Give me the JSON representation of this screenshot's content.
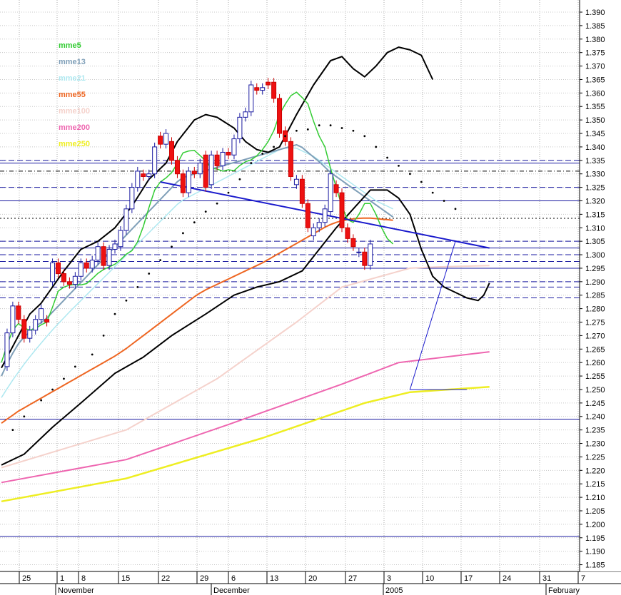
{
  "chart_data": {
    "type": "line",
    "title": "",
    "xlabel": "",
    "ylabel": "",
    "ylim": [
      1.1825,
      1.3945
    ],
    "y_ticks": [
      "1.390",
      "1.385",
      "1.380",
      "1.375",
      "1.370",
      "1.365",
      "1.360",
      "1.355",
      "1.350",
      "1.345",
      "1.340",
      "1.335",
      "1.330",
      "1.325",
      "1.320",
      "1.315",
      "1.310",
      "1.305",
      "1.300",
      "1.295",
      "1.290",
      "1.285",
      "1.280",
      "1.275",
      "1.270",
      "1.265",
      "1.260",
      "1.255",
      "1.250",
      "1.245",
      "1.240",
      "1.235",
      "1.230",
      "1.225",
      "1.220",
      "1.215",
      "1.210",
      "1.205",
      "1.200",
      "1.195",
      "1.190",
      "1.185"
    ],
    "x_day_ticks": [
      "25",
      "1",
      "8",
      "15",
      "22",
      "29",
      "6",
      "13",
      "20",
      "27",
      "3",
      "10",
      "17",
      "24",
      "31",
      "7"
    ],
    "x_month_labels": [
      "November",
      "December",
      "2005",
      "February"
    ],
    "legend": [
      {
        "name": "mme5",
        "color": "#33cc33"
      },
      {
        "name": "mme13",
        "color": "#7f9fb8"
      },
      {
        "name": "mme21",
        "color": "#aee8f0"
      },
      {
        "name": "mme55",
        "color": "#ee6622"
      },
      {
        "name": "mme100",
        "color": "#f5d2cc"
      },
      {
        "name": "mme200",
        "color": "#ee66b0"
      },
      {
        "name": "mme250",
        "color": "#eeee22"
      }
    ],
    "grid": true,
    "legend_position": "top-left",
    "candles": [
      [
        1.2585,
        1.271
      ],
      [
        1.271,
        1.281
      ],
      [
        1.281,
        1.276
      ],
      [
        1.276,
        1.269
      ],
      [
        1.269,
        1.272
      ],
      [
        1.272,
        1.276
      ],
      [
        1.276,
        1.28
      ],
      [
        1.276,
        1.275
      ],
      [
        1.29,
        1.297
      ],
      [
        1.297,
        1.293
      ],
      [
        1.293,
        1.29
      ],
      [
        1.29,
        1.289
      ],
      [
        1.289,
        1.292
      ],
      [
        1.292,
        1.297
      ],
      [
        1.297,
        1.295
      ],
      [
        1.295,
        1.298
      ],
      [
        1.298,
        1.303
      ],
      [
        1.303,
        1.296
      ],
      [
        1.296,
        1.302
      ],
      [
        1.302,
        1.304
      ],
      [
        1.303,
        1.309
      ],
      [
        1.309,
        1.317
      ],
      [
        1.317,
        1.325
      ],
      [
        1.325,
        1.331
      ],
      [
        1.33,
        1.329
      ],
      [
        1.329,
        1.33
      ],
      [
        1.33,
        1.34
      ],
      [
        1.344,
        1.341
      ],
      [
        1.341,
        1.345
      ],
      [
        1.342,
        1.335
      ],
      [
        1.335,
        1.33
      ],
      [
        1.33,
        1.323
      ],
      [
        1.323,
        1.331
      ],
      [
        1.331,
        1.33
      ],
      [
        1.33,
        1.334
      ],
      [
        1.337,
        1.325
      ],
      [
        1.326,
        1.337
      ],
      [
        1.337,
        1.333
      ],
      [
        1.333,
        1.338
      ],
      [
        1.338,
        1.337
      ],
      [
        1.337,
        1.343
      ],
      [
        1.343,
        1.351
      ],
      [
        1.351,
        1.353
      ],
      [
        1.353,
        1.363
      ],
      [
        1.362,
        1.361
      ],
      [
        1.361,
        1.362
      ],
      [
        1.364,
        1.363
      ],
      [
        1.364,
        1.358
      ],
      [
        1.358,
        1.345
      ],
      [
        1.346,
        1.342
      ],
      [
        1.342,
        1.329
      ],
      [
        1.326,
        1.328
      ],
      [
        1.328,
        1.319
      ],
      [
        1.319,
        1.31
      ],
      [
        1.307,
        1.31
      ],
      [
        1.31,
        1.312
      ],
      [
        1.312,
        1.317
      ],
      [
        1.316,
        1.33
      ],
      [
        1.326,
        1.323
      ],
      [
        1.323,
        1.31
      ],
      [
        1.31,
        1.306
      ],
      [
        1.306,
        1.303
      ],
      [
        1.301,
        1.301
      ],
      [
        1.301,
        1.296
      ],
      [
        1.296,
        1.304
      ]
    ],
    "series": [
      {
        "name": "mme5",
        "values": [
          1.26,
          1.2665,
          1.272,
          1.2745,
          1.2728,
          1.272,
          1.2726,
          1.274,
          1.275,
          1.2805,
          1.2865,
          1.288,
          1.2887,
          1.289,
          1.2888,
          1.2893,
          1.2911,
          1.2931,
          1.2945,
          1.2955,
          1.2965,
          1.2982,
          1.3002,
          1.3015,
          1.3048,
          1.3105,
          1.3175,
          1.324,
          1.327,
          1.3285,
          1.3305,
          1.3339,
          1.3378,
          1.3385,
          1.3387,
          1.3368,
          1.3348,
          1.332,
          1.3318,
          1.331,
          1.3315,
          1.3312,
          1.3331,
          1.3345,
          1.3352,
          1.3367,
          1.339,
          1.342,
          1.346,
          1.3521,
          1.3558,
          1.359,
          1.3603,
          1.3583,
          1.356,
          1.3495,
          1.344,
          1.34,
          1.332,
          1.325,
          1.318,
          1.313,
          1.312,
          1.315,
          1.319,
          1.319,
          1.315,
          1.31,
          1.306,
          1.304
        ]
      },
      {
        "name": "mme13",
        "values": [
          1.255,
          1.2595,
          1.2635,
          1.267,
          1.2695,
          1.2713,
          1.2735,
          1.2748,
          1.2765,
          1.2787,
          1.2809,
          1.2831,
          1.2853,
          1.2875,
          1.2897,
          1.2919,
          1.2941,
          1.2963,
          1.2985,
          1.3007,
          1.3029,
          1.3051,
          1.3073,
          1.3095,
          1.3117,
          1.3139,
          1.3161,
          1.3183,
          1.3205,
          1.3227,
          1.3249,
          1.3271,
          1.3286,
          1.3293,
          1.33,
          1.3306,
          1.3312,
          1.3318,
          1.3324,
          1.333,
          1.3336,
          1.3342,
          1.3348,
          1.3354,
          1.336,
          1.3366,
          1.3372,
          1.3378,
          1.3384,
          1.339,
          1.3396,
          1.3402,
          1.3408,
          1.3398,
          1.338,
          1.3362,
          1.3345,
          1.3325,
          1.3305,
          1.329,
          1.3275,
          1.326,
          1.3245,
          1.323,
          1.3215,
          1.32,
          1.3185,
          1.317,
          1.3155,
          1.314
        ]
      },
      {
        "name": "mme21",
        "values": [
          1.247,
          1.2503,
          1.2535,
          1.2565,
          1.2594,
          1.2621,
          1.2647,
          1.2672,
          1.2697,
          1.2721,
          1.2744,
          1.2766,
          1.2788,
          1.2809,
          1.283,
          1.2851,
          1.2872,
          1.2893,
          1.2914,
          1.2935,
          1.2956,
          1.2977,
          1.2998,
          1.3019,
          1.304,
          1.3061,
          1.3082,
          1.3103,
          1.3124,
          1.3145,
          1.3166,
          1.3187,
          1.3203,
          1.3214,
          1.3225,
          1.3236,
          1.3247,
          1.3258,
          1.3269,
          1.328,
          1.3291,
          1.3302,
          1.3313,
          1.3324,
          1.3335,
          1.3346,
          1.3357,
          1.3368,
          1.3379,
          1.339,
          1.3395,
          1.3397,
          1.3395,
          1.3385,
          1.3375,
          1.3365,
          1.335,
          1.3335,
          1.332,
          1.3305,
          1.329,
          1.3275,
          1.326,
          1.3245,
          1.323,
          1.3215,
          1.32,
          1.319,
          1.318,
          1.317
        ]
      },
      {
        "name": "mme55",
        "values": [
          1.2375,
          1.239,
          1.2405,
          1.242,
          1.2432,
          1.2444,
          1.2456,
          1.2468,
          1.248,
          1.2492,
          1.2504,
          1.2516,
          1.2528,
          1.254,
          1.2552,
          1.2564,
          1.2576,
          1.2588,
          1.26,
          1.2612,
          1.2624,
          1.2638,
          1.2652,
          1.2668,
          1.2684,
          1.27,
          1.2716,
          1.2732,
          1.2748,
          1.2764,
          1.278,
          1.2796,
          1.2812,
          1.2828,
          1.2844,
          1.2858,
          1.287,
          1.288,
          1.289,
          1.29,
          1.291,
          1.292,
          1.293,
          1.294,
          1.295,
          1.296,
          1.297,
          1.2982,
          1.2994,
          1.3006,
          1.3018,
          1.303,
          1.3042,
          1.3054,
          1.3066,
          1.3078,
          1.309,
          1.3102,
          1.3112,
          1.312,
          1.3126,
          1.313,
          1.3133,
          1.3135,
          1.3136,
          1.3136,
          1.3134,
          1.3132,
          1.313,
          1.3128
        ]
      }
    ],
    "bands_upper_points": [
      [
        1.258,
        0
      ],
      [
        1.27,
        3
      ],
      [
        1.278,
        5
      ],
      [
        1.282,
        7
      ],
      [
        1.288,
        9
      ],
      [
        1.294,
        11
      ],
      [
        1.302,
        14
      ],
      [
        1.305,
        17
      ],
      [
        1.31,
        20
      ],
      [
        1.318,
        23
      ],
      [
        1.328,
        26
      ],
      [
        1.334,
        29
      ],
      [
        1.342,
        31
      ],
      [
        1.35,
        34
      ],
      [
        1.352,
        36
      ],
      [
        1.351,
        38
      ],
      [
        1.347,
        41
      ],
      [
        1.342,
        43
      ],
      [
        1.339,
        45
      ],
      [
        1.338,
        47
      ],
      [
        1.34,
        49
      ],
      [
        1.352,
        52
      ],
      [
        1.363,
        55
      ],
      [
        1.372,
        58
      ],
      [
        1.3735,
        60
      ],
      [
        1.369,
        62
      ],
      [
        1.366,
        64
      ],
      [
        1.37,
        66
      ],
      [
        1.375,
        68
      ],
      [
        1.377,
        70
      ],
      [
        1.376,
        72
      ],
      [
        1.374,
        74
      ],
      [
        1.365,
        76
      ]
    ],
    "bands_lower_points": [
      [
        1.222,
        0
      ],
      [
        1.226,
        4
      ],
      [
        1.236,
        9
      ],
      [
        1.245,
        14
      ],
      [
        1.256,
        20
      ],
      [
        1.262,
        25
      ],
      [
        1.27,
        30
      ],
      [
        1.278,
        36
      ],
      [
        1.285,
        41
      ],
      [
        1.288,
        45
      ],
      [
        1.29,
        49
      ],
      [
        1.294,
        53
      ],
      [
        1.302,
        56
      ],
      [
        1.31,
        59
      ],
      [
        1.317,
        62
      ],
      [
        1.324,
        65
      ],
      [
        1.324,
        68
      ],
      [
        1.321,
        70
      ],
      [
        1.315,
        72
      ],
      [
        1.302,
        74
      ],
      [
        1.292,
        76
      ],
      [
        1.288,
        78
      ],
      [
        1.286,
        80
      ],
      [
        1.284,
        82
      ],
      [
        1.283,
        84
      ],
      [
        1.285,
        85
      ],
      [
        1.2895,
        86
      ]
    ],
    "mme100_points": [
      [
        1.221,
        0
      ],
      [
        1.235,
        22
      ],
      [
        1.254,
        38
      ],
      [
        1.275,
        52
      ],
      [
        1.288,
        60
      ],
      [
        1.295,
        72
      ],
      [
        1.2955,
        77
      ],
      [
        1.296,
        86
      ]
    ],
    "mme200_points": [
      [
        1.2155,
        0
      ],
      [
        1.224,
        22
      ],
      [
        1.237,
        40
      ],
      [
        1.252,
        60
      ],
      [
        1.26,
        70
      ],
      [
        1.264,
        86
      ]
    ],
    "mme250_points": [
      [
        1.2085,
        0
      ],
      [
        1.217,
        22
      ],
      [
        1.232,
        46
      ],
      [
        1.245,
        64
      ],
      [
        1.249,
        72
      ],
      [
        1.251,
        86
      ]
    ],
    "trend_line": [
      [
        1.327,
        28
      ],
      [
        1.3025,
        86
      ]
    ],
    "support_line": [
      [
        1.25,
        72
      ],
      [
        1.305,
        80
      ]
    ],
    "support_base": [
      [
        1.25,
        72
      ],
      [
        1.25,
        82
      ]
    ],
    "psar_dots": [
      [
        1.235,
        2
      ],
      [
        1.24,
        4
      ],
      [
        1.246,
        7
      ],
      [
        1.25,
        9
      ],
      [
        1.254,
        11
      ],
      [
        1.2585,
        13
      ],
      [
        1.263,
        16
      ],
      [
        1.27,
        18
      ],
      [
        1.278,
        20
      ],
      [
        1.283,
        22
      ],
      [
        1.288,
        24
      ],
      [
        1.293,
        26
      ],
      [
        1.298,
        28
      ],
      [
        1.303,
        30
      ],
      [
        1.308,
        32
      ],
      [
        1.312,
        34
      ],
      [
        1.316,
        36
      ],
      [
        1.319,
        38
      ],
      [
        1.323,
        40
      ],
      [
        1.328,
        42
      ],
      [
        1.334,
        44
      ],
      [
        1.3375,
        46
      ],
      [
        1.34,
        48
      ],
      [
        1.344,
        50
      ],
      [
        1.346,
        52
      ],
      [
        1.3465,
        54
      ],
      [
        1.348,
        56
      ],
      [
        1.348,
        58
      ],
      [
        1.347,
        60
      ],
      [
        1.346,
        62
      ],
      [
        1.344,
        64
      ],
      [
        1.34,
        66
      ],
      [
        1.336,
        68
      ],
      [
        1.333,
        70
      ],
      [
        1.33,
        72
      ],
      [
        1.327,
        74
      ],
      [
        1.323,
        76
      ],
      [
        1.32,
        78
      ],
      [
        1.317,
        80
      ]
    ],
    "h_lines": [
      {
        "y": 1.335,
        "style": "dash"
      },
      {
        "y": 1.334,
        "style": "solid"
      },
      {
        "y": 1.331,
        "style": "dashdot"
      },
      {
        "y": 1.325,
        "style": "dash"
      },
      {
        "y": 1.32,
        "style": "solid"
      },
      {
        "y": 1.3135,
        "style": "dot"
      },
      {
        "y": 1.305,
        "style": "dash"
      },
      {
        "y": 1.3025,
        "style": "solid"
      },
      {
        "y": 1.3,
        "style": "dash"
      },
      {
        "y": 1.2975,
        "style": "dash"
      },
      {
        "y": 1.295,
        "style": "solid"
      },
      {
        "y": 1.29,
        "style": "dash"
      },
      {
        "y": 1.288,
        "style": "dash"
      },
      {
        "y": 1.284,
        "style": "dash"
      },
      {
        "y": 1.239,
        "style": "solid"
      },
      {
        "y": 1.1955,
        "style": "solid"
      }
    ]
  }
}
